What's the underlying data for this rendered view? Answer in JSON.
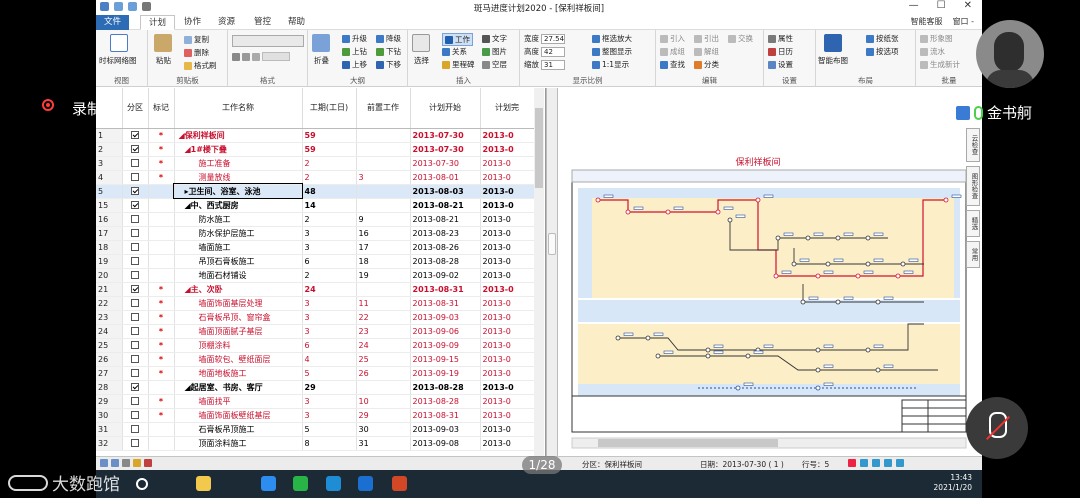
{
  "app": {
    "title": "斑马进度计划2020 - [保利祥板间]",
    "menu": {
      "file": "文件",
      "tabs": [
        "计划",
        "协作",
        "资源",
        "管控",
        "帮助"
      ],
      "right": [
        "智能客服",
        "窗口 -"
      ]
    },
    "ribbon": {
      "groups": [
        "视图",
        "剪贴板",
        "格式",
        "大纲",
        "插入",
        "显示比例",
        "编辑",
        "设置",
        "布局",
        "批量"
      ],
      "view_btn": "时标网络图",
      "paste": "粘贴",
      "clipboard": [
        "复制",
        "删除",
        "格式刷"
      ],
      "outline_big": "折叠",
      "outline": [
        "升级",
        "降级",
        "上钻",
        "下钻",
        "上移",
        "下移"
      ],
      "select": "选择",
      "insert": [
        "工作",
        "文字",
        "关系",
        "图片",
        "里程碑",
        "空层"
      ],
      "zoom_labels": [
        "宽度",
        "高度",
        "缩放"
      ],
      "zoom_values": [
        "27.54",
        "42",
        "31"
      ],
      "zoom_btns": [
        "框选放大",
        "整图显示",
        "1:1显示"
      ],
      "edit": [
        "引入",
        "引出",
        "交换",
        "成组",
        "解组",
        "查找",
        "分类"
      ],
      "settings": [
        "属性",
        "日历",
        "设置"
      ],
      "layout_big": "智能布图",
      "layout": [
        "按纸张",
        "按选项"
      ],
      "batch": [
        "形象图",
        "流水",
        "生成新计"
      ]
    },
    "grid": {
      "headers": [
        "分区",
        "标记",
        "工作名称",
        "工期(工日)",
        "前置工作",
        "计划开始",
        "计划完"
      ],
      "rows": [
        {
          "n": "1",
          "check": true,
          "mark": "*",
          "name": "◢保利祥板间",
          "dur": "59",
          "pre": "",
          "start": "2013-07-30",
          "end": "2013-0",
          "style": "red bold",
          "indent": 0
        },
        {
          "n": "2",
          "check": true,
          "mark": "*",
          "name": "◢1#楼下叠",
          "dur": "59",
          "pre": "",
          "start": "2013-07-30",
          "end": "2013-0",
          "style": "red bold",
          "indent": 1
        },
        {
          "n": "3",
          "check": false,
          "mark": "*",
          "name": "施工准备",
          "dur": "2",
          "pre": "",
          "start": "2013-07-30",
          "end": "2013-0",
          "style": "red",
          "indent": 2
        },
        {
          "n": "4",
          "check": false,
          "mark": "*",
          "name": "测量放线",
          "dur": "2",
          "pre": "3",
          "start": "2013-08-01",
          "end": "2013-0",
          "style": "red",
          "indent": 2
        },
        {
          "n": "5",
          "check": true,
          "mark": "",
          "name": "▸卫生间、浴室、泳池",
          "dur": "48",
          "pre": "",
          "start": "2013-08-03",
          "end": "2013-0",
          "style": "bold",
          "indent": 1,
          "sel": true
        },
        {
          "n": "15",
          "check": true,
          "mark": "",
          "name": "◢中、西式厨房",
          "dur": "14",
          "pre": "",
          "start": "2013-08-21",
          "end": "2013-0",
          "style": "bold",
          "indent": 1
        },
        {
          "n": "16",
          "check": false,
          "mark": "",
          "name": "防水施工",
          "dur": "2",
          "pre": "9",
          "start": "2013-08-21",
          "end": "2013-0",
          "style": "",
          "indent": 2
        },
        {
          "n": "17",
          "check": false,
          "mark": "",
          "name": "防水保护层施工",
          "dur": "3",
          "pre": "16",
          "start": "2013-08-23",
          "end": "2013-0",
          "style": "",
          "indent": 2
        },
        {
          "n": "18",
          "check": false,
          "mark": "",
          "name": "墙面施工",
          "dur": "3",
          "pre": "17",
          "start": "2013-08-26",
          "end": "2013-0",
          "style": "",
          "indent": 2
        },
        {
          "n": "19",
          "check": false,
          "mark": "",
          "name": "吊顶石膏板施工",
          "dur": "6",
          "pre": "18",
          "start": "2013-08-28",
          "end": "2013-0",
          "style": "",
          "indent": 2
        },
        {
          "n": "20",
          "check": false,
          "mark": "",
          "name": "地面石材铺设",
          "dur": "2",
          "pre": "19",
          "start": "2013-09-02",
          "end": "2013-0",
          "style": "",
          "indent": 2
        },
        {
          "n": "21",
          "check": true,
          "mark": "*",
          "name": "◢主、次卧",
          "dur": "24",
          "pre": "",
          "start": "2013-08-31",
          "end": "2013-0",
          "style": "red bold",
          "indent": 1
        },
        {
          "n": "22",
          "check": false,
          "mark": "*",
          "name": "墙面饰面基层处理",
          "dur": "3",
          "pre": "11",
          "start": "2013-08-31",
          "end": "2013-0",
          "style": "red",
          "indent": 2
        },
        {
          "n": "23",
          "check": false,
          "mark": "*",
          "name": "石膏板吊顶、窗帘盒",
          "dur": "3",
          "pre": "22",
          "start": "2013-09-03",
          "end": "2013-0",
          "style": "red",
          "indent": 2
        },
        {
          "n": "24",
          "check": false,
          "mark": "*",
          "name": "墙面顶面腻子基层",
          "dur": "3",
          "pre": "23",
          "start": "2013-09-06",
          "end": "2013-0",
          "style": "red",
          "indent": 2
        },
        {
          "n": "25",
          "check": false,
          "mark": "*",
          "name": "顶棚涂料",
          "dur": "6",
          "pre": "24",
          "start": "2013-09-09",
          "end": "2013-0",
          "style": "red",
          "indent": 2
        },
        {
          "n": "26",
          "check": false,
          "mark": "*",
          "name": "墙面软包、壁纸面层",
          "dur": "4",
          "pre": "25",
          "start": "2013-09-15",
          "end": "2013-0",
          "style": "red",
          "indent": 2
        },
        {
          "n": "27",
          "check": false,
          "mark": "*",
          "name": "地面地板施工",
          "dur": "5",
          "pre": "26",
          "start": "2013-09-19",
          "end": "2013-0",
          "style": "red",
          "indent": 2
        },
        {
          "n": "28",
          "check": true,
          "mark": "",
          "name": "◢起居室、书房、客厅",
          "dur": "29",
          "pre": "",
          "start": "2013-08-28",
          "end": "2013-0",
          "style": "bold",
          "indent": 1
        },
        {
          "n": "29",
          "check": false,
          "mark": "*",
          "name": "墙面找平",
          "dur": "3",
          "pre": "10",
          "start": "2013-08-28",
          "end": "2013-0",
          "style": "red",
          "indent": 2
        },
        {
          "n": "30",
          "check": false,
          "mark": "*",
          "name": "墙面饰面板壁纸基层",
          "dur": "3",
          "pre": "29",
          "start": "2013-08-31",
          "end": "2013-0",
          "style": "red",
          "indent": 2
        },
        {
          "n": "31",
          "check": false,
          "mark": "",
          "name": "石膏板吊顶施工",
          "dur": "5",
          "pre": "30",
          "start": "2013-09-03",
          "end": "2013-0",
          "style": "",
          "indent": 2
        },
        {
          "n": "32",
          "check": false,
          "mark": "",
          "name": "顶面涂料施工",
          "dur": "8",
          "pre": "31",
          "start": "2013-09-08",
          "end": "2013-0",
          "style": "",
          "indent": 2
        }
      ]
    },
    "chart": {
      "title": "保利祥板间"
    },
    "right_tabs": [
      "云检查",
      "图形检查",
      "精选",
      "常用"
    ],
    "status": {
      "partition": "分区：保利祥板间",
      "date": "日期：2013-07-30 ( 1 )",
      "row": "行号：5"
    }
  },
  "overlay": {
    "record_label": "录制中",
    "participant_name": "金书舸",
    "page_indicator": "1/28",
    "watermark": "大数跑馆"
  },
  "taskbar": {
    "time": "13:43",
    "date": "2021/1/20"
  },
  "colors": {
    "accent": "#2d6bb5",
    "critical": "#c8102e",
    "band_yellow": "#fcefc8",
    "band_blue": "#d7e7f7"
  }
}
